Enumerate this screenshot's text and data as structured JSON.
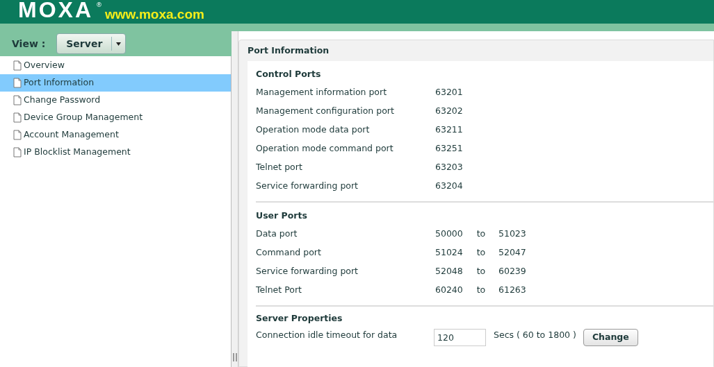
{
  "header": {
    "logo": "MOXA",
    "registered": "®",
    "url": "www.moxa.com"
  },
  "view": {
    "label": "View :",
    "value": "Server"
  },
  "sidebar": {
    "items": [
      {
        "label": "Overview",
        "selected": false
      },
      {
        "label": "Port Information",
        "selected": true
      },
      {
        "label": "Change Password",
        "selected": false
      },
      {
        "label": "Device Group Management",
        "selected": false
      },
      {
        "label": "Account Management",
        "selected": false
      },
      {
        "label": "IP Blocklist Management",
        "selected": false
      }
    ]
  },
  "panel": {
    "title": "Port Information",
    "sections": [
      {
        "title": "Control Ports",
        "rows": [
          {
            "label": "Management information port",
            "values": [
              "63201"
            ]
          },
          {
            "label": "Management configuration port",
            "values": [
              "63202"
            ]
          },
          {
            "label": "Operation mode data port",
            "values": [
              "63211"
            ]
          },
          {
            "label": "Operation mode command port",
            "values": [
              "63251"
            ]
          },
          {
            "label": "Telnet port",
            "values": [
              "63203"
            ]
          },
          {
            "label": "Service forwarding port",
            "values": [
              "63204"
            ]
          }
        ]
      },
      {
        "title": "User Ports",
        "rows": [
          {
            "label": "Data port",
            "values": [
              "50000",
              "to",
              "51023"
            ]
          },
          {
            "label": "Command port",
            "values": [
              "51024",
              "to",
              "52047"
            ]
          },
          {
            "label": "Service forwarding port",
            "values": [
              "52048",
              "to",
              "60239"
            ]
          },
          {
            "label": "Telnet Port",
            "values": [
              "60240",
              "to",
              "61263"
            ]
          }
        ]
      }
    ],
    "properties": {
      "title": "Server Properties",
      "label": "Connection idle timeout for data",
      "value": "120",
      "hint": "Secs ( 60 to 1800 )",
      "button": "Change"
    }
  }
}
